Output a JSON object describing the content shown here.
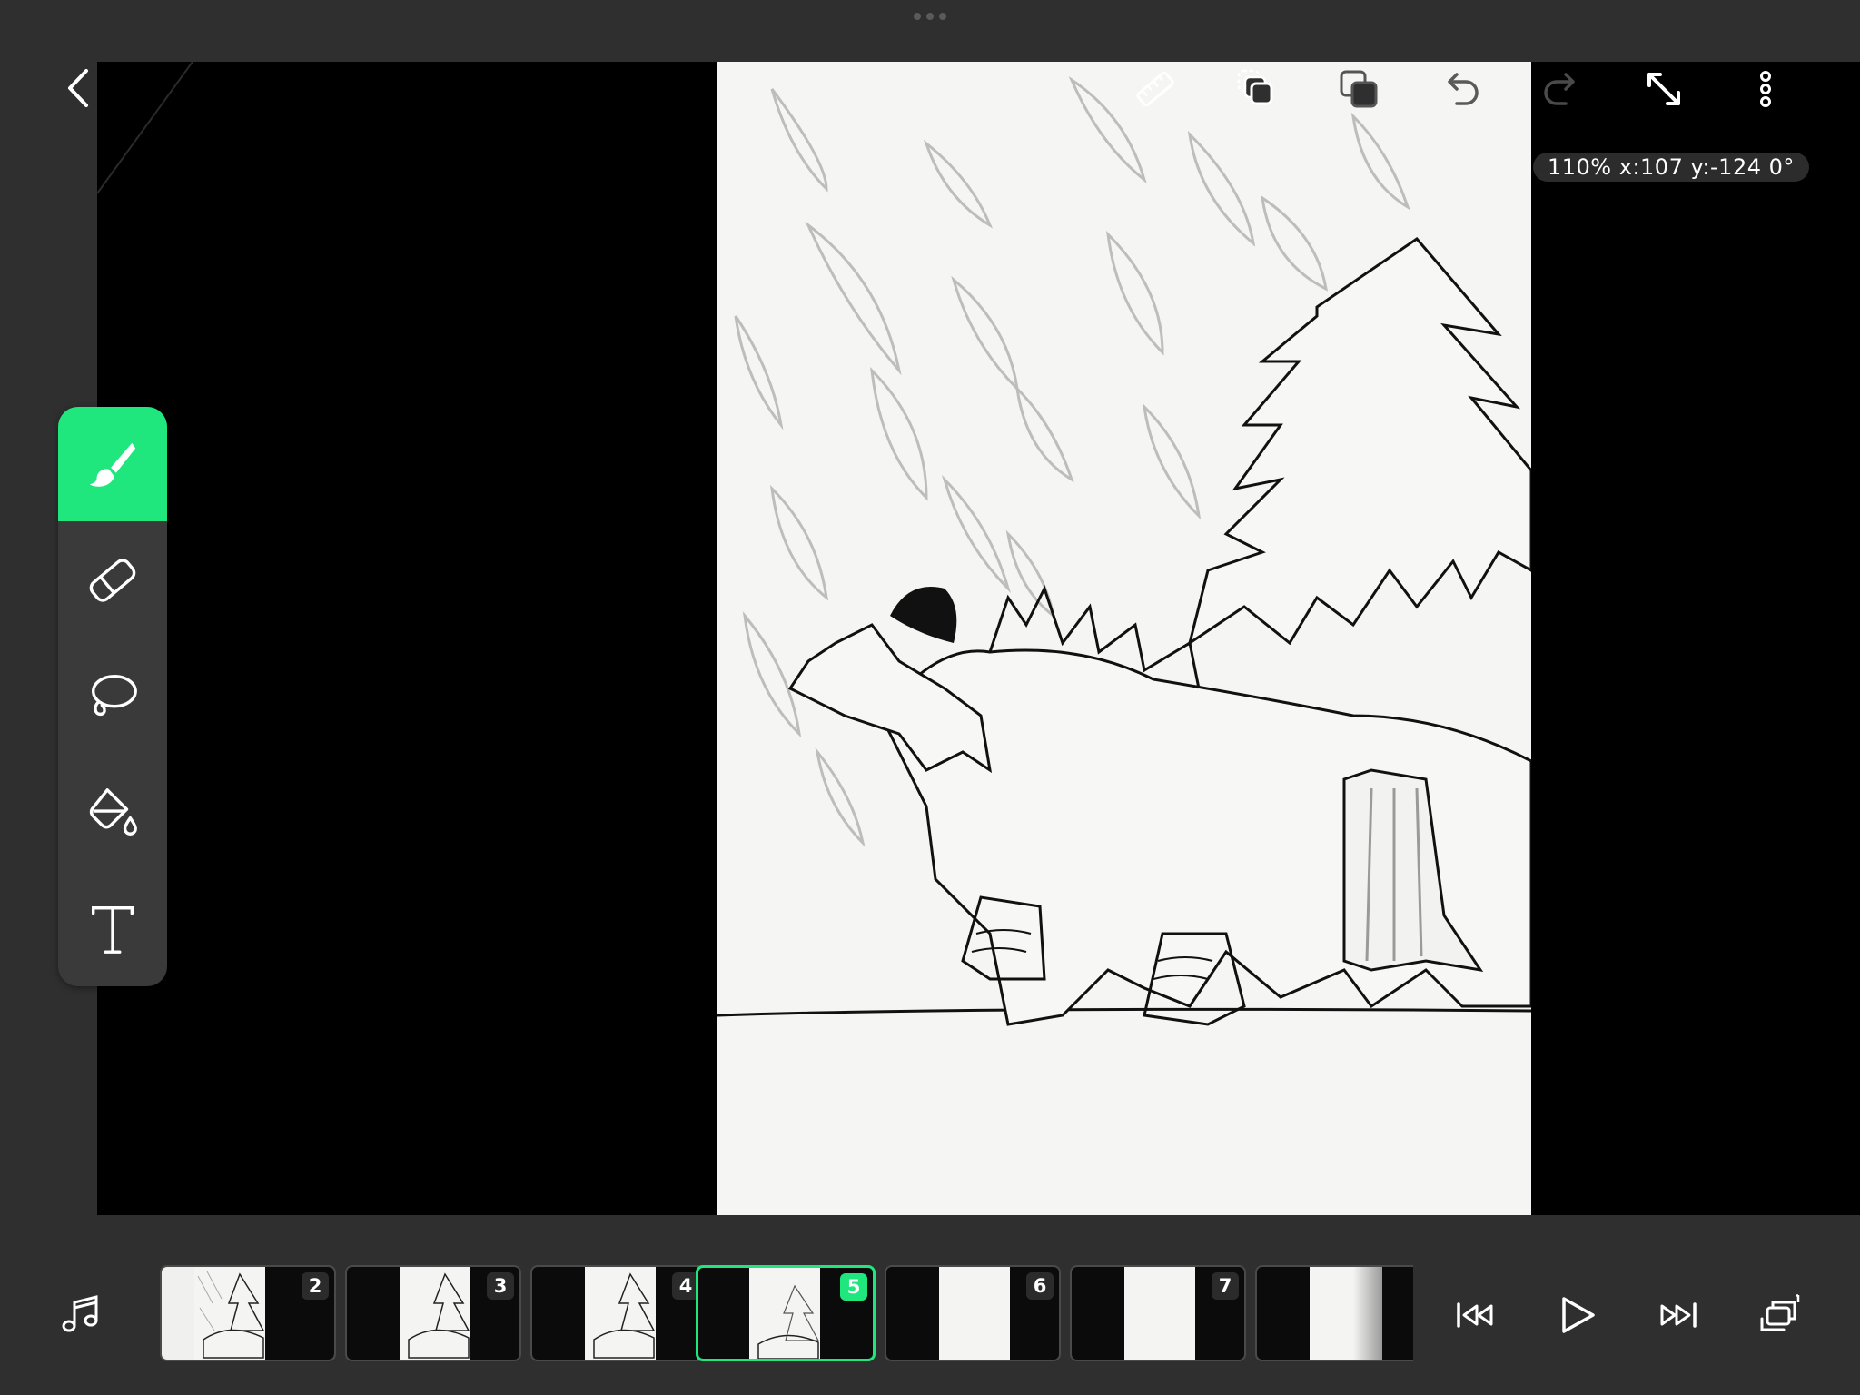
{
  "canvas_status": {
    "zoom_readout": "110% x:107 y:-124 0°"
  },
  "toolbox": {
    "tools": [
      {
        "name": "brush",
        "icon": "brush-icon",
        "active": true
      },
      {
        "name": "eraser",
        "icon": "eraser-icon",
        "active": false
      },
      {
        "name": "lasso",
        "icon": "lasso-icon",
        "active": false
      },
      {
        "name": "fill",
        "icon": "paint-bucket-icon",
        "active": false
      },
      {
        "name": "text",
        "icon": "text-icon",
        "active": false
      }
    ]
  },
  "topbar": {
    "icons": [
      "ruler-icon",
      "onion-skin-icon",
      "layers-icon",
      "undo-icon",
      "redo-icon",
      "resize-icon",
      "more-icon"
    ]
  },
  "timeline": {
    "frames": [
      {
        "number": "2",
        "selected": false
      },
      {
        "number": "3",
        "selected": false
      },
      {
        "number": "4",
        "selected": false
      },
      {
        "number": "5",
        "selected": true
      },
      {
        "number": "6",
        "selected": false
      },
      {
        "number": "7",
        "selected": false
      },
      {
        "number": "",
        "selected": false
      }
    ]
  },
  "playback": {
    "icons": [
      "music-icon",
      "skip-back-icon",
      "play-icon",
      "skip-forward-icon",
      "frames-stack-icon"
    ]
  },
  "colors": {
    "accent": "#1fe77e",
    "background": "#2f2f2f",
    "stage": "#000000",
    "paper": "#f5f5f3"
  }
}
